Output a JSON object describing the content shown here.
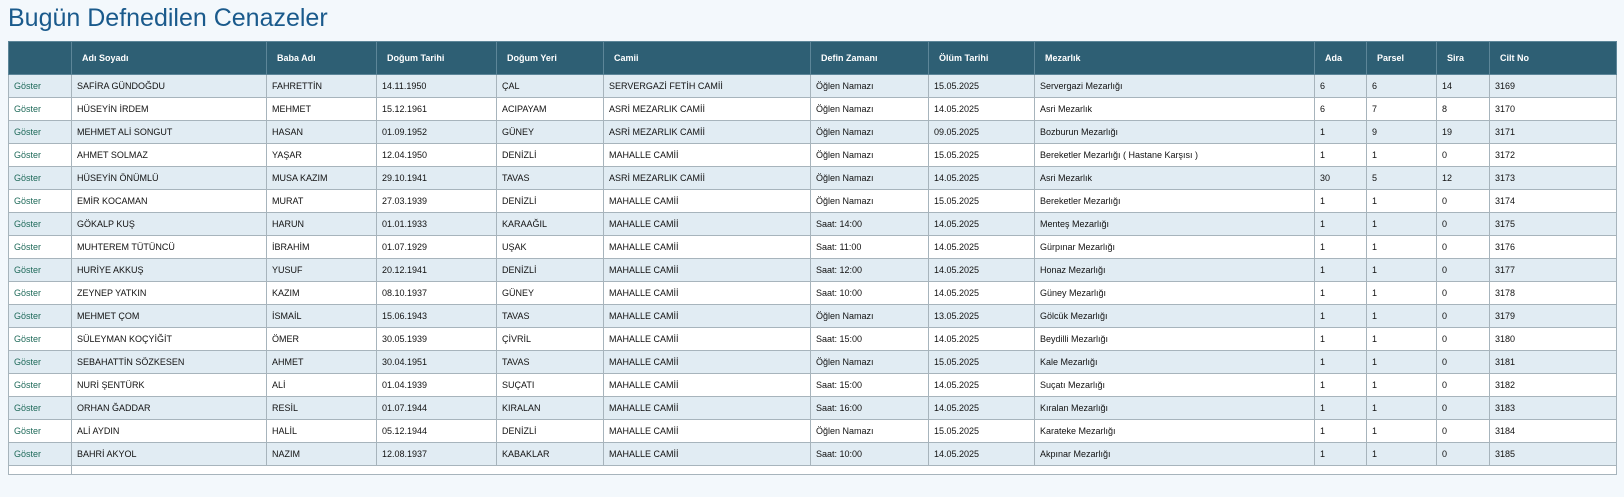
{
  "page": {
    "title": "Bugün Defnedilen Cenazeler"
  },
  "table": {
    "headers": [
      "",
      "Adı Soyadı",
      "Baba Adı",
      "Doğum Tarihi",
      "Doğum Yeri",
      "Camii",
      "Defin Zamanı",
      "Ölüm Tarihi",
      "Mezarlık",
      "Ada",
      "Parsel",
      "Sira",
      "Cilt No"
    ],
    "link_label": "Göster",
    "rows": [
      [
        "SAFİRA GÜNDOĞDU",
        "FAHRETTİN",
        "14.11.1950",
        "ÇAL",
        "SERVERGAZİ FETİH CAMİİ",
        "Öğlen Namazı",
        "15.05.2025",
        "Servergazi Mezarlığı",
        "6",
        "6",
        "14",
        "3169"
      ],
      [
        "HÜSEYİN İRDEM",
        "MEHMET",
        "15.12.1961",
        "ACIPAYAM",
        "ASRİ MEZARLIK CAMİİ",
        "Öğlen Namazı",
        "14.05.2025",
        "Asri Mezarlık",
        "6",
        "7",
        "8",
        "3170"
      ],
      [
        "MEHMET ALİ SONGUT",
        "HASAN",
        "01.09.1952",
        "GÜNEY",
        "ASRİ MEZARLIK CAMİİ",
        "Öğlen Namazı",
        "09.05.2025",
        "Bozburun Mezarlığı",
        "1",
        "9",
        "19",
        "3171"
      ],
      [
        "AHMET SOLMAZ",
        "YAŞAR",
        "12.04.1950",
        "DENİZLİ",
        "MAHALLE CAMİİ",
        "Öğlen Namazı",
        "15.05.2025",
        "Bereketler Mezarlığı ( Hastane Karşısı )",
        "1",
        "1",
        "0",
        "3172"
      ],
      [
        "HÜSEYİN ÖNÜMLÜ",
        "MUSA KAZIM",
        "29.10.1941",
        "TAVAS",
        "ASRİ MEZARLIK CAMİİ",
        "Öğlen Namazı",
        "14.05.2025",
        "Asri Mezarlık",
        "30",
        "5",
        "12",
        "3173"
      ],
      [
        "EMİR KOCAMAN",
        "MURAT",
        "27.03.1939",
        "DENİZLİ",
        "MAHALLE CAMİİ",
        "Öğlen Namazı",
        "15.05.2025",
        "Bereketler Mezarlığı",
        "1",
        "1",
        "0",
        "3174"
      ],
      [
        "GÖKALP KUŞ",
        "HARUN",
        "01.01.1933",
        "KARAAĞIL",
        "MAHALLE CAMİİ",
        "Saat: 14:00",
        "14.05.2025",
        "Menteş Mezarlığı",
        "1",
        "1",
        "0",
        "3175"
      ],
      [
        "MUHTEREM TÜTÜNCÜ",
        "İBRAHİM",
        "01.07.1929",
        "UŞAK",
        "MAHALLE CAMİİ",
        "Saat: 11:00",
        "14.05.2025",
        "Gürpınar Mezarlığı",
        "1",
        "1",
        "0",
        "3176"
      ],
      [
        "HURİYE AKKUŞ",
        "YUSUF",
        "20.12.1941",
        "DENİZLİ",
        "MAHALLE CAMİİ",
        "Saat: 12:00",
        "14.05.2025",
        "Honaz Mezarlığı",
        "1",
        "1",
        "0",
        "3177"
      ],
      [
        "ZEYNEP YATKIN",
        "KAZIM",
        "08.10.1937",
        "GÜNEY",
        "MAHALLE CAMİİ",
        "Saat: 10:00",
        "14.05.2025",
        "Güney Mezarlığı",
        "1",
        "1",
        "0",
        "3178"
      ],
      [
        "MEHMET ÇOM",
        "İSMAİL",
        "15.06.1943",
        "TAVAS",
        "MAHALLE CAMİİ",
        "Öğlen Namazı",
        "13.05.2025",
        "Gölcük Mezarlığı",
        "1",
        "1",
        "0",
        "3179"
      ],
      [
        "SÜLEYMAN KOÇYİĞİT",
        "ÖMER",
        "30.05.1939",
        "ÇİVRİL",
        "MAHALLE CAMİİ",
        "Saat: 15:00",
        "14.05.2025",
        "Beydilli Mezarlığı",
        "1",
        "1",
        "0",
        "3180"
      ],
      [
        "SEBAHATTİN SÖZKESEN",
        "AHMET",
        "30.04.1951",
        "TAVAS",
        "MAHALLE CAMİİ",
        "Öğlen Namazı",
        "15.05.2025",
        "Kale Mezarlığı",
        "1",
        "1",
        "0",
        "3181"
      ],
      [
        "NURİ ŞENTÜRK",
        "ALİ",
        "01.04.1939",
        "SUÇATI",
        "MAHALLE CAMİİ",
        "Saat: 15:00",
        "14.05.2025",
        "Suçatı Mezarlığı",
        "1",
        "1",
        "0",
        "3182"
      ],
      [
        "ORHAN ĞADDAR",
        "RESİL",
        "01.07.1944",
        "KIRALAN",
        "MAHALLE CAMİİ",
        "Saat: 16:00",
        "14.05.2025",
        "Kıralan Mezarlığı",
        "1",
        "1",
        "0",
        "3183"
      ],
      [
        "ALİ AYDIN",
        "HALİL",
        "05.12.1944",
        "DENİZLİ",
        "MAHALLE CAMİİ",
        "Öğlen Namazı",
        "15.05.2025",
        "Karateke Mezarlığı",
        "1",
        "1",
        "0",
        "3184"
      ],
      [
        "BAHRİ AKYOL",
        "NAZIM",
        "12.08.1937",
        "KABAKLAR",
        "MAHALLE CAMİİ",
        "Saat: 10:00",
        "14.05.2025",
        "Akpınar Mezarlığı",
        "1",
        "1",
        "0",
        "3185"
      ]
    ]
  }
}
